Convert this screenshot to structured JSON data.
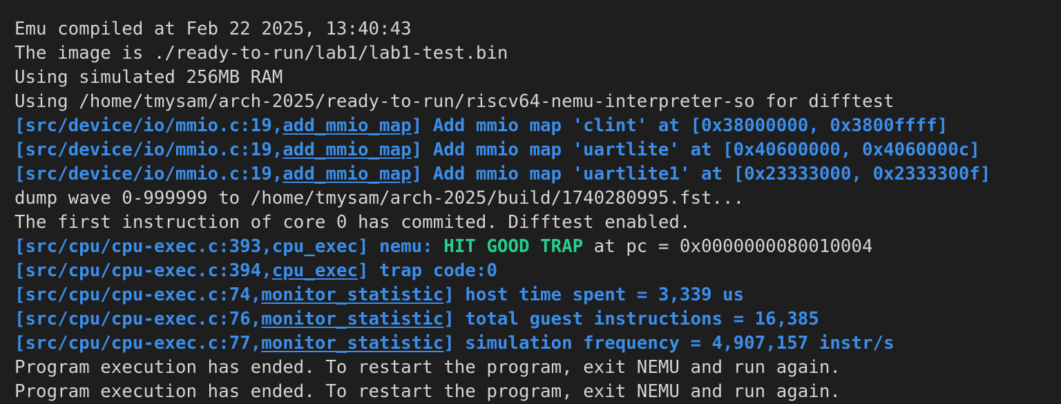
{
  "terminal": {
    "colors": {
      "background": "#1e1e1e",
      "plain": "#d4d4d4",
      "info_blue": "#3b8eea",
      "success_green": "#23d18b"
    },
    "lines": [
      [
        {
          "text": "Emu compiled at Feb 22 2025, 13:40:43",
          "style": "plain"
        }
      ],
      [
        {
          "text": "The image is ./ready-to-run/lab1/lab1-test.bin",
          "style": "plain"
        }
      ],
      [
        {
          "text": "Using simulated 256MB RAM",
          "style": "plain"
        }
      ],
      [
        {
          "text": "Using /home/tmysam/arch-2025/ready-to-run/riscv64-nemu-interpreter-so for difftest",
          "style": "plain"
        }
      ],
      [
        {
          "text": "[src/device/io/mmio.c:19,",
          "style": "blue"
        },
        {
          "text": "add_mmio_map",
          "style": "blue",
          "underline": true
        },
        {
          "text": "] Add mmio map 'clint' at [0x38000000, 0x3800ffff]",
          "style": "blue"
        }
      ],
      [
        {
          "text": "[src/device/io/mmio.c:19,",
          "style": "blue"
        },
        {
          "text": "add_mmio_map",
          "style": "blue",
          "underline": true
        },
        {
          "text": "] Add mmio map 'uartlite' at [0x40600000, 0x4060000c]",
          "style": "blue"
        }
      ],
      [
        {
          "text": "[src/device/io/mmio.c:19,",
          "style": "blue"
        },
        {
          "text": "add_mmio_map",
          "style": "blue",
          "underline": true
        },
        {
          "text": "] Add mmio map 'uartlite1' at [0x23333000, 0x2333300f]",
          "style": "blue"
        }
      ],
      [
        {
          "text": "dump wave 0-999999 to /home/tmysam/arch-2025/build/1740280995.fst...",
          "style": "plain"
        }
      ],
      [
        {
          "text": "The first instruction of core 0 has commited. Difftest enabled.",
          "style": "plain"
        }
      ],
      [
        {
          "text": "[src/cpu/cpu-exec.c:393,cpu_exec] nemu: ",
          "style": "blue"
        },
        {
          "text": "HIT GOOD TRAP",
          "style": "green"
        },
        {
          "text": " at pc = 0x0000000080010004",
          "style": "plain"
        }
      ],
      [
        {
          "text": "[src/cpu/cpu-exec.c:394,",
          "style": "blue"
        },
        {
          "text": "cpu_exec",
          "style": "blue",
          "underline": true
        },
        {
          "text": "] trap code:0",
          "style": "blue"
        }
      ],
      [
        {
          "text": "[src/cpu/cpu-exec.c:74,",
          "style": "blue"
        },
        {
          "text": "monitor_statistic",
          "style": "blue",
          "underline": true
        },
        {
          "text": "] host time spent = 3,339 us",
          "style": "blue"
        }
      ],
      [
        {
          "text": "[src/cpu/cpu-exec.c:76,",
          "style": "blue"
        },
        {
          "text": "monitor_statistic",
          "style": "blue",
          "underline": true
        },
        {
          "text": "] total guest instructions = 16,385",
          "style": "blue"
        }
      ],
      [
        {
          "text": "[src/cpu/cpu-exec.c:77,",
          "style": "blue"
        },
        {
          "text": "monitor_statistic",
          "style": "blue",
          "underline": true
        },
        {
          "text": "] simulation frequency = 4,907,157 instr/s",
          "style": "blue"
        }
      ],
      [
        {
          "text": "Program execution has ended. To restart the program, exit NEMU and run again.",
          "style": "plain"
        }
      ],
      [
        {
          "text": "Program execution has ended. To restart the program, exit NEMU and run again.",
          "style": "plain"
        }
      ]
    ]
  }
}
